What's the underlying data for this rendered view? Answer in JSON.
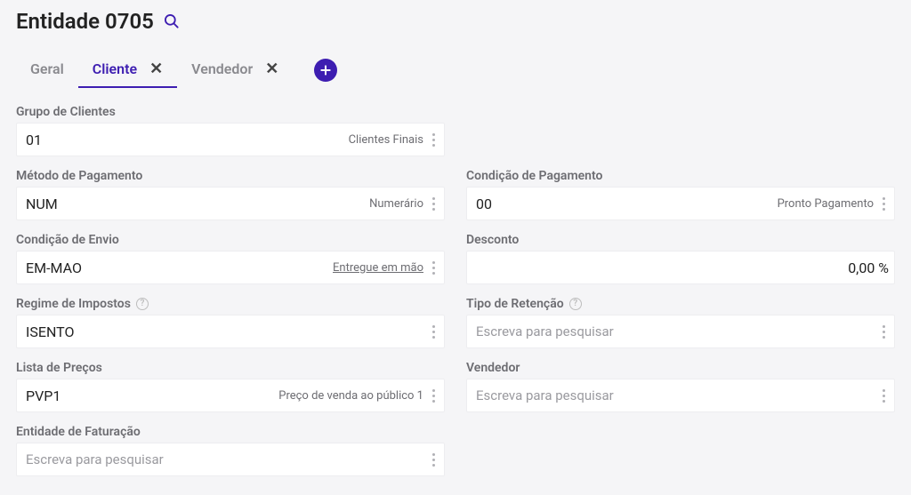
{
  "title": "Entidade 0705",
  "tabs": {
    "geral": "Geral",
    "cliente": "Cliente",
    "vendedor": "Vendedor"
  },
  "fields": {
    "grupo_clientes": {
      "label": "Grupo de Clientes",
      "value": "01",
      "hint": "Clientes Finais"
    },
    "metodo_pagamento": {
      "label": "Método de Pagamento",
      "value": "NUM",
      "hint": "Numerário"
    },
    "condicao_pagamento": {
      "label": "Condição de Pagamento",
      "value": "00",
      "hint": "Pronto Pagamento"
    },
    "condicao_envio": {
      "label": "Condição de Envio",
      "value": "EM-MAO",
      "hint": "Entregue em mão"
    },
    "desconto": {
      "label": "Desconto",
      "value": "0,00 %"
    },
    "regime_impostos": {
      "label": "Regime de Impostos",
      "value": "ISENTO"
    },
    "tipo_retencao": {
      "label": "Tipo de Retenção",
      "placeholder": "Escreva para pesquisar"
    },
    "lista_precos": {
      "label": "Lista de Preços",
      "value": "PVP1",
      "hint": "Preço de venda ao público 1"
    },
    "vendedor": {
      "label": "Vendedor",
      "placeholder": "Escreva para pesquisar"
    },
    "entidade_faturacao": {
      "label": "Entidade de Faturação",
      "placeholder": "Escreva para pesquisar"
    }
  }
}
